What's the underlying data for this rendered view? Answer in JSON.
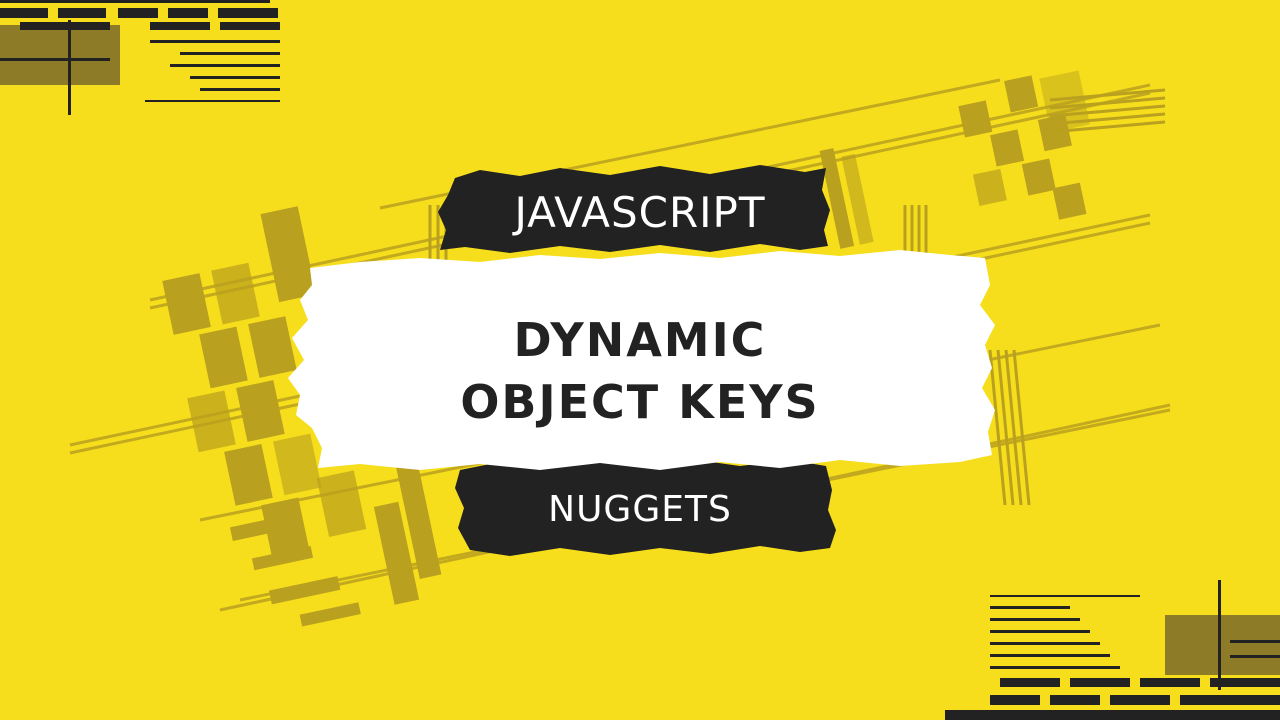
{
  "banner": {
    "kicker": "JAVASCRIPT",
    "title_line_1": "DYNAMIC",
    "title_line_2": "OBJECT KEYS",
    "series": "NUGGETS"
  },
  "colors": {
    "background": "#f6de1d",
    "pattern": "#b9a01e",
    "dark_brush": "#222222",
    "white_brush": "#ffffff"
  }
}
